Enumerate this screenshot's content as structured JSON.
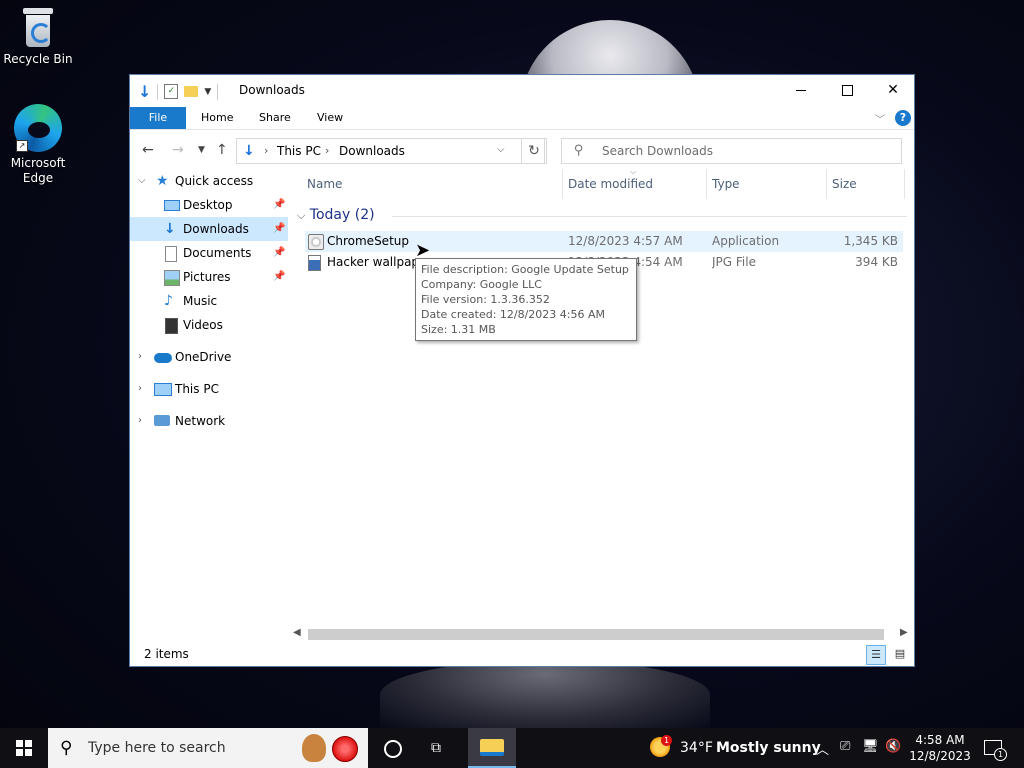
{
  "desktop": {
    "icons": [
      {
        "label": "Recycle Bin"
      },
      {
        "label": "Microsoft Edge"
      }
    ]
  },
  "window": {
    "title": "Downloads",
    "ribbon_tabs": {
      "file": "File",
      "home": "Home",
      "share": "Share",
      "view": "View"
    },
    "address": {
      "crumb1": "This PC",
      "crumb2": "Downloads"
    },
    "search_placeholder": "Search Downloads",
    "nav_pane": {
      "quick_access": "Quick access",
      "desktop": "Desktop",
      "downloads": "Downloads",
      "documents": "Documents",
      "pictures": "Pictures",
      "music": "Music",
      "videos": "Videos",
      "onedrive": "OneDrive",
      "this_pc": "This PC",
      "network": "Network"
    },
    "columns": {
      "name": "Name",
      "date": "Date modified",
      "type": "Type",
      "size": "Size"
    },
    "group_header": "Today (2)",
    "files": [
      {
        "name": "ChromeSetup",
        "date": "12/8/2023 4:57 AM",
        "type": "Application",
        "size": "1,345 KB"
      },
      {
        "name": "Hacker wallpaper",
        "date": "12/8/2023 4:54 AM",
        "type": "JPG File",
        "size": "394 KB"
      }
    ],
    "tooltip": {
      "line1": "File description: Google Update Setup",
      "line2": "Company: Google LLC",
      "line3": "File version: 1.3.36.352",
      "line4": "Date created: 12/8/2023 4:56 AM",
      "line5": "Size: 1.31 MB"
    },
    "status": "2 items"
  },
  "taskbar": {
    "search_placeholder": "Type here to search",
    "weather_badge": "1",
    "temperature": "34°F",
    "condition": "Mostly sunny",
    "time": "4:58 AM",
    "date": "12/8/2023",
    "notification_count": "1"
  },
  "colors": {
    "accent": "#1979ca",
    "selection": "#cce8ff",
    "taskbar": "#101014"
  }
}
